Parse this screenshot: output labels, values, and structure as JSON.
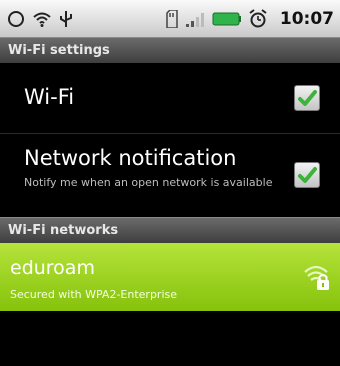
{
  "status_bar": {
    "icons_left": [
      "sync-icon",
      "wifi-icon",
      "usb-icon"
    ],
    "icons_right": [
      "sd-card-icon",
      "signal-icon",
      "battery-icon",
      "alarm-icon"
    ],
    "time": "10:07",
    "battery_color": "#2fb34a"
  },
  "sections": {
    "wifi_settings": "Wi-Fi settings",
    "wifi_networks": "Wi-Fi networks"
  },
  "settings": {
    "wifi": {
      "label": "Wi-Fi",
      "checked": true
    },
    "network_notification": {
      "label": "Network notification",
      "summary": "Notify me when an open network is available",
      "checked": true
    }
  },
  "networks": [
    {
      "ssid": "eduroam",
      "security": "Secured with WPA2-Enterprise",
      "icon": "wifi-lock-icon"
    }
  ],
  "colors": {
    "accent_green": "#9fd31c",
    "check_green": "#3cb33a"
  }
}
